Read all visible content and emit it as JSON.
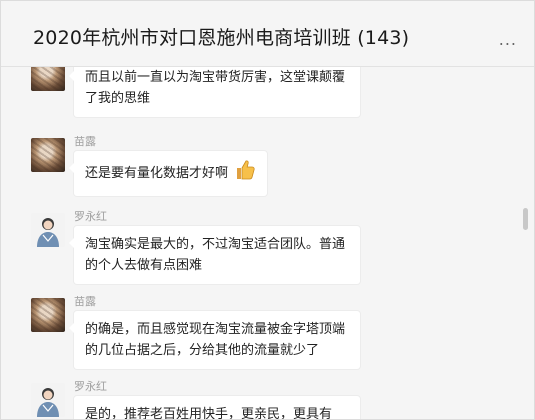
{
  "window": {
    "controls": {
      "pin": "☶",
      "minimize": "—",
      "maximize": "□",
      "close": "✕"
    }
  },
  "chat": {
    "title": "2020年杭州市对口恩施州电商培训班 (143)",
    "more_label": "..."
  },
  "messages": [
    {
      "sender": "",
      "avatar": "avatar-miaolu",
      "text": "而且以前一直以为淘宝带货厉害，这堂课颠覆了我的思维"
    },
    {
      "sender": "苗露",
      "avatar": "avatar-miaolu",
      "text": "还是要有量化数据才好啊",
      "emoji": "thumbs-up-icon"
    },
    {
      "sender": "罗永红",
      "avatar": "avatar-lyh",
      "text": "淘宝确实是最大的，不过淘宝适合团队。普通的个人去做有点困难"
    },
    {
      "sender": "苗露",
      "avatar": "avatar-miaolu",
      "text": "的确是，而且感觉现在淘宝流量被金字塔顶端的几位占据之后，分给其他的流量就少了"
    },
    {
      "sender": "罗永红",
      "avatar": "avatar-lyh",
      "text": "是的，推荐老百姓用快手，更亲民，更具有"
    }
  ],
  "colors": {
    "background": "#f5f5f5",
    "bubble": "#ffffff",
    "sender_name": "#a0a0a0",
    "text": "#222222"
  }
}
